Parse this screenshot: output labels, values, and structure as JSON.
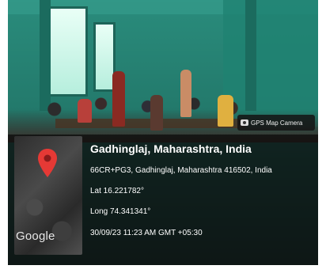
{
  "badge": {
    "label": "GPS Map Camera",
    "icon": "camera-icon"
  },
  "map": {
    "logo": "Google",
    "pin_color": "#e53935"
  },
  "location": {
    "city": "Gadhinglaj, Maharashtra, India",
    "address": "66CR+PG3, Gadhinglaj, Maharashtra 416502, India",
    "lat": "Lat 16.221782°",
    "long": "Long 74.341341°",
    "datetime": "30/09/23 11:23 AM GMT +05:30"
  }
}
